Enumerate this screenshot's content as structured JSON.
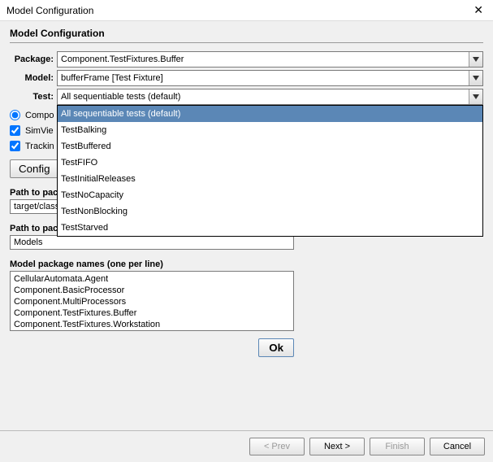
{
  "window": {
    "title": "Model Configuration",
    "section_title": "Model Configuration"
  },
  "form": {
    "package_label": "Package:",
    "package_value": "Component.TestFixtures.Buffer",
    "model_label": "Model:",
    "model_value": "bufferFrame [Test Fixture]",
    "test_label": "Test:",
    "test_value": "All sequentiable tests (default)",
    "test_options": [
      "All sequentiable tests (default)",
      "TestBalking",
      "TestBuffered",
      "TestFIFO",
      "TestInitialReleases",
      "TestNoCapacity",
      "TestNonBlocking",
      "TestStarved"
    ]
  },
  "options": {
    "component_label": "Compo",
    "simview_label": "SimVie",
    "tracking_label": "Trackin",
    "configure_label": "Config"
  },
  "paths": {
    "classes_label": "Path to packages of model classes (from current folder)",
    "classes_value": "target/classes",
    "source_label": "Path to packages of model source files (from current folder)",
    "source_value": "Models",
    "packages_label": "Model package names (one per line)",
    "packages_value": "CellularAutomata.Agent\nComponent.BasicProcessor\nComponent.MultiProcessors\nComponent.TestFixtures.Buffer\nComponent.TestFixtures.Workstation"
  },
  "buttons": {
    "ok": "Ok",
    "prev": "< Prev",
    "next": "Next >",
    "finish": "Finish",
    "cancel": "Cancel"
  }
}
